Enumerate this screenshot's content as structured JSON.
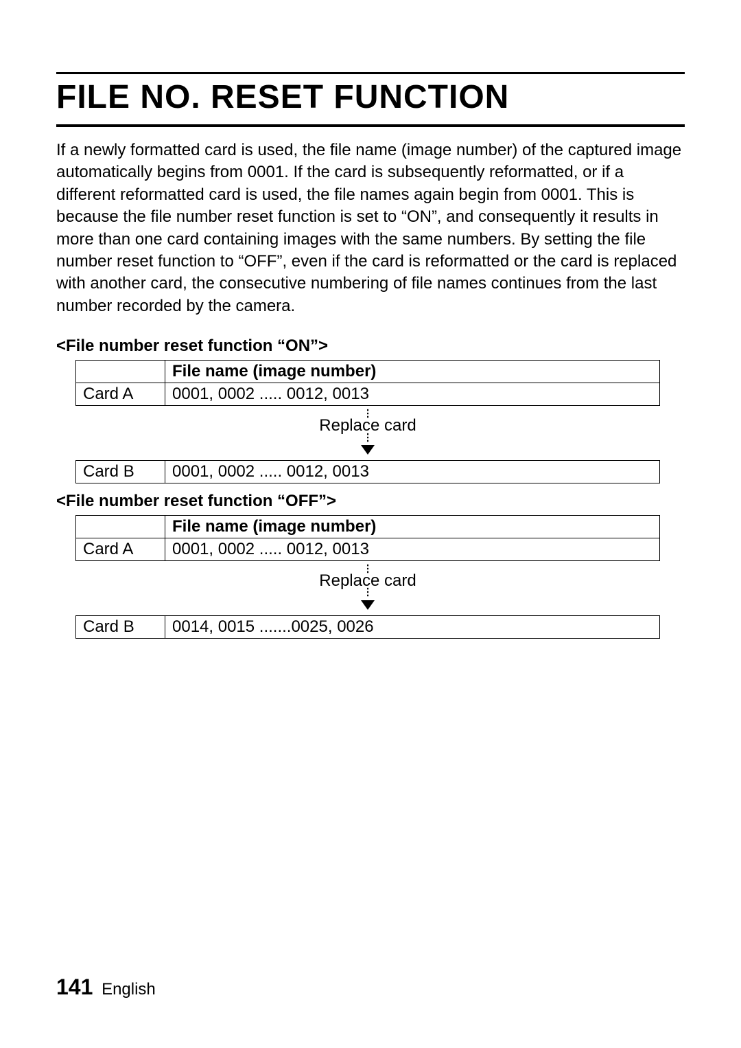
{
  "title": "FILE NO. RESET FUNCTION",
  "body": "If a newly formatted card is used, the file name (image number) of the captured image automatically begins from 0001. If the card is subsequently reformatted, or if a different reformatted card is used, the file names again begin from 0001. This is because the file number reset function is set to “ON”, and consequently it results in more than one card containing images with the same numbers. By setting the file number reset function to “OFF”, even if the card is reformatted or the card is replaced with another card, the consecutive numbering of file names continues from the last number recorded by the camera.",
  "on": {
    "heading": "<File number reset function “ON”>",
    "col_header": "File name (image number)",
    "card_a_label": "Card A",
    "card_a_values": "0001, 0002 ..... 0012, 0013",
    "replace": "Replace card",
    "card_b_label": "Card B",
    "card_b_values": "0001, 0002 ..... 0012, 0013"
  },
  "off": {
    "heading": "<File number reset function “OFF”>",
    "col_header": "File name (image number)",
    "card_a_label": "Card A",
    "card_a_values": "0001, 0002 ..... 0012, 0013",
    "replace": "Replace card",
    "card_b_label": "Card B",
    "card_b_values": "0014, 0015 .......0025, 0026"
  },
  "footer": {
    "page": "141",
    "lang": "English"
  }
}
